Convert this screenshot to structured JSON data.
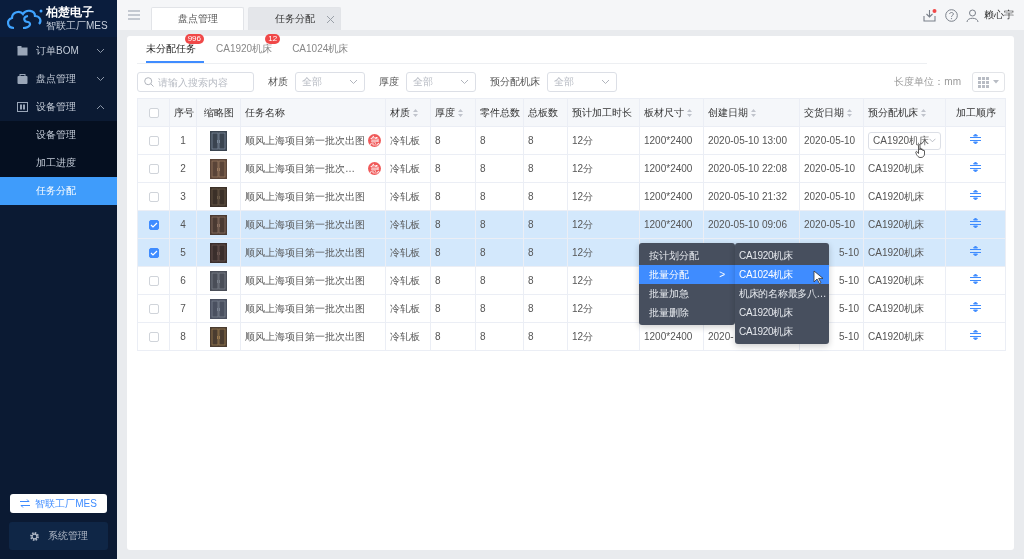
{
  "sidebar": {
    "logo": {
      "title": "柏楚电子",
      "subtitle": "智联工厂MES"
    },
    "menu": [
      {
        "label": "订单BOM",
        "expanded": false
      },
      {
        "label": "盘点管理",
        "expanded": false
      },
      {
        "label": "设备管理",
        "expanded": true,
        "children": [
          {
            "label": "设备管理",
            "selected": false
          },
          {
            "label": "加工进度",
            "selected": false
          },
          {
            "label": "任务分配",
            "selected": true
          }
        ]
      }
    ],
    "switch_button": "智联工厂MES",
    "settings_button": "系统管理"
  },
  "topbar": {
    "tabs": [
      {
        "label": "盘点管理",
        "selected": false,
        "closable": false
      },
      {
        "label": "任务分配",
        "selected": true,
        "closable": true
      }
    ],
    "notification": true,
    "user": "赖心宇"
  },
  "subtabs": [
    {
      "label": "未分配任务",
      "badge": "996",
      "selected": true
    },
    {
      "label": "CA1920机床",
      "badge": "12",
      "selected": false
    },
    {
      "label": "CA1024机床",
      "selected": false
    }
  ],
  "filters": {
    "search": {
      "placeholder": "请输入搜索内容"
    },
    "selects": [
      {
        "label": "材质",
        "placeholder": "全部"
      },
      {
        "label": "厚度",
        "placeholder": "全部"
      },
      {
        "label": "预分配机床",
        "placeholder": "全部"
      }
    ],
    "unit": "长度单位：mm"
  },
  "table": {
    "columns": [
      {
        "kind": "checkbox",
        "checked": false
      },
      {
        "label": "序号",
        "sortable": false
      },
      {
        "label": "缩略图",
        "sortable": false
      },
      {
        "label": "任务名称",
        "sortable": false
      },
      {
        "label": "材质",
        "sortable": true
      },
      {
        "label": "厚度",
        "sortable": true
      },
      {
        "label": "零件总数",
        "sortable": false
      },
      {
        "label": "总板数",
        "sortable": false
      },
      {
        "label": "预计加工时长",
        "sortable": false
      },
      {
        "label": "板材尺寸",
        "sortable": true
      },
      {
        "label": "创建日期",
        "sortable": true
      },
      {
        "label": "交货日期",
        "sortable": true
      },
      {
        "label": "预分配机床",
        "sortable": true
      },
      {
        "label": "加工顺序",
        "sortable": false
      }
    ],
    "rows": [
      {
        "checked": false,
        "no": "1",
        "name": "顺风上海项目第一批次出图",
        "urgent": true,
        "urgent_label": "急",
        "material": "冷轧板",
        "thickness": "8",
        "parts": "8",
        "boards": "8",
        "duration": "12分",
        "size": "1200*2400",
        "created": "2020-05-10 13:00",
        "delivery": "2020-05-10",
        "machine": "CA1920机床",
        "editing": true
      },
      {
        "checked": false,
        "no": "2",
        "name": "顺风上海项目第一批次…",
        "urgent": true,
        "urgent_label": "急",
        "material": "冷轧板",
        "thickness": "8",
        "parts": "8",
        "boards": "8",
        "duration": "12分",
        "size": "1200*2400",
        "created": "2020-05-10 22:08",
        "delivery": "2020-05-10",
        "machine": "CA1920机床",
        "editing": false
      },
      {
        "checked": false,
        "no": "3",
        "name": "顺风上海项目第一批次出图",
        "urgent": false,
        "material": "冷轧板",
        "thickness": "8",
        "parts": "8",
        "boards": "8",
        "duration": "12分",
        "size": "1200*2400",
        "created": "2020-05-10 21:32",
        "delivery": "2020-05-10",
        "machine": "CA1920机床",
        "editing": false
      },
      {
        "checked": true,
        "no": "4",
        "name": "顺风上海项目第一批次出图",
        "urgent": false,
        "material": "冷轧板",
        "thickness": "8",
        "parts": "8",
        "boards": "8",
        "duration": "12分",
        "size": "1200*2400",
        "created": "2020-05-10 09:06",
        "delivery": "2020-05-10",
        "machine": "CA1920机床",
        "editing": false
      },
      {
        "checked": true,
        "no": "5",
        "name": "顺风上海项目第一批次出图",
        "urgent": false,
        "material": "冷轧板",
        "thickness": "8",
        "parts": "8",
        "boards": "8",
        "duration": "12分",
        "delivery": "5-10",
        "delivery_cut": true,
        "machine": "CA1920机床",
        "editing": false
      },
      {
        "checked": false,
        "no": "6",
        "name": "顺风上海项目第一批次出图",
        "urgent": false,
        "material": "冷轧板",
        "thickness": "8",
        "parts": "8",
        "boards": "8",
        "duration": "12分",
        "delivery": "5-10",
        "delivery_cut": true,
        "machine": "CA1920机床",
        "editing": false
      },
      {
        "checked": false,
        "no": "7",
        "name": "顺风上海项目第一批次出图",
        "urgent": false,
        "material": "冷轧板",
        "thickness": "8",
        "parts": "8",
        "boards": "8",
        "duration": "12分",
        "delivery": "5-10",
        "delivery_cut": true,
        "machine": "CA1920机床",
        "editing": false
      },
      {
        "checked": false,
        "no": "8",
        "name": "顺风上海项目第一批次出图",
        "urgent": false,
        "material": "冷轧板",
        "thickness": "8",
        "parts": "8",
        "boards": "8",
        "duration": "12分",
        "size": "1200*2400",
        "created": "2020-",
        "delivery": "5-10",
        "delivery_cut": true,
        "machine": "CA1920机床",
        "editing": false
      }
    ]
  },
  "context_menu": {
    "items": [
      {
        "label": "按计划分配",
        "selected": false
      },
      {
        "label": "批量分配",
        "selected": true,
        "arrow": ">"
      },
      {
        "label": "批量加急",
        "selected": false
      },
      {
        "label": "批量删除",
        "selected": false
      }
    ],
    "submenu": [
      {
        "label": "CA1920机床",
        "selected": false
      },
      {
        "label": "CA1024机床",
        "selected": true
      },
      {
        "label": "机床的名称最多八…",
        "selected": false
      },
      {
        "label": "CA1920机床",
        "selected": false
      },
      {
        "label": "CA1920机床",
        "selected": false
      }
    ]
  }
}
